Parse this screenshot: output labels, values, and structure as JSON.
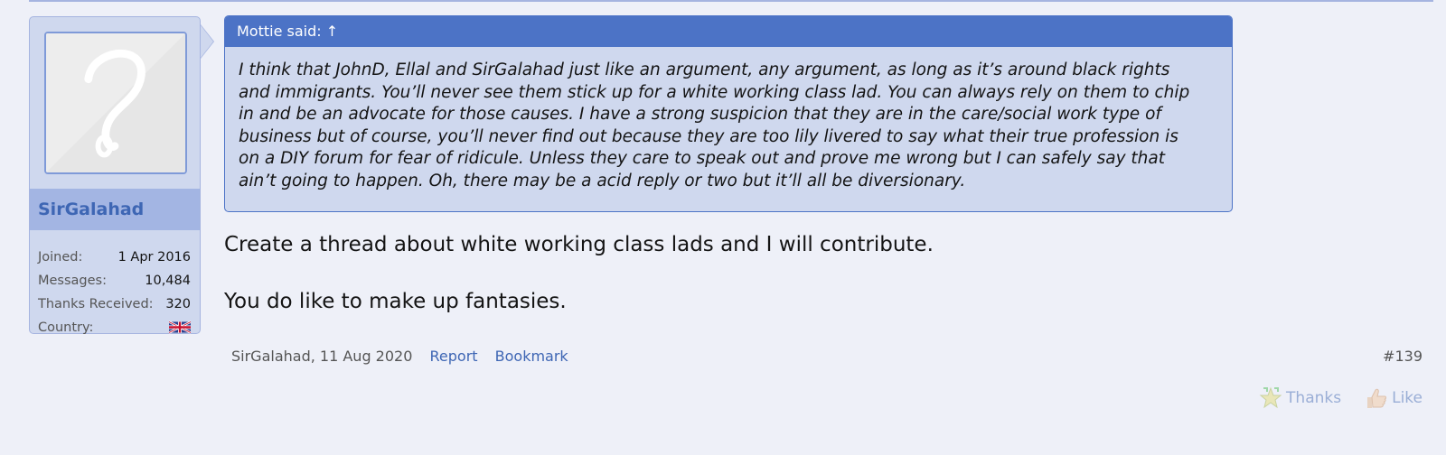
{
  "user": {
    "name": "SirGalahad",
    "stats": [
      {
        "label": "Joined:",
        "value": "1 Apr 2016"
      },
      {
        "label": "Messages:",
        "value": "10,484"
      },
      {
        "label": "Thanks Received:",
        "value": "320"
      },
      {
        "label": "Country:",
        "value": ""
      }
    ],
    "country_flag": "uk-flag-icon"
  },
  "quote": {
    "header": "Mottie said: ↑",
    "lines": [
      "I think that JohnD, Ellal and SirGalahad just like an argument, any argument, as long as it’s around black rights",
      "and immigrants. You’ll never see them stick up for a white working class lad. You can always rely on them to chip",
      "in and be an advocate for those causes. I have a strong suspicion that they are in the care/social work type of",
      "business but of course, you’ll never find out because they are too lily livered to say what their true profession is",
      "on a DIY forum for fear of ridicule. Unless they care to speak out and prove me wrong but I can safely say that",
      "ain’t going to happen. Oh, there may be a acid reply or two but it’ll all be diversionary."
    ]
  },
  "message": {
    "line1": "Create a thread about white working class lads and I will contribute.",
    "line2": "You do like to make up fantasies."
  },
  "footer": {
    "author_date": "SirGalahad, 11 Aug 2020",
    "report": "Report",
    "bookmark": "Bookmark",
    "post_number": "#139"
  },
  "reactions": {
    "thanks": "Thanks",
    "like": "Like"
  },
  "colors": {
    "accent": "#4c73c6",
    "sidebar_bg": "#cfd8ee",
    "username": "#3e66b4",
    "background": "#eef0f8"
  }
}
